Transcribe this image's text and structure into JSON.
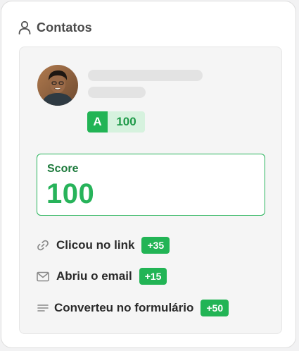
{
  "header": {
    "title": "Contatos",
    "icon": "user-icon"
  },
  "contact": {
    "grade": "A",
    "grade_score": "100"
  },
  "score": {
    "label": "Score",
    "value": "100"
  },
  "activities": [
    {
      "icon": "link-icon",
      "label": "Clicou no link",
      "points": "+35"
    },
    {
      "icon": "mail-icon",
      "label": "Abriu o email",
      "points": "+15"
    },
    {
      "icon": "form-icon",
      "label": "Converteu no formulário",
      "points": "+50"
    }
  ],
  "colors": {
    "accent_green": "#22b455",
    "accent_green_light": "#d6f2de",
    "score_label_green": "#1d7a3c"
  }
}
